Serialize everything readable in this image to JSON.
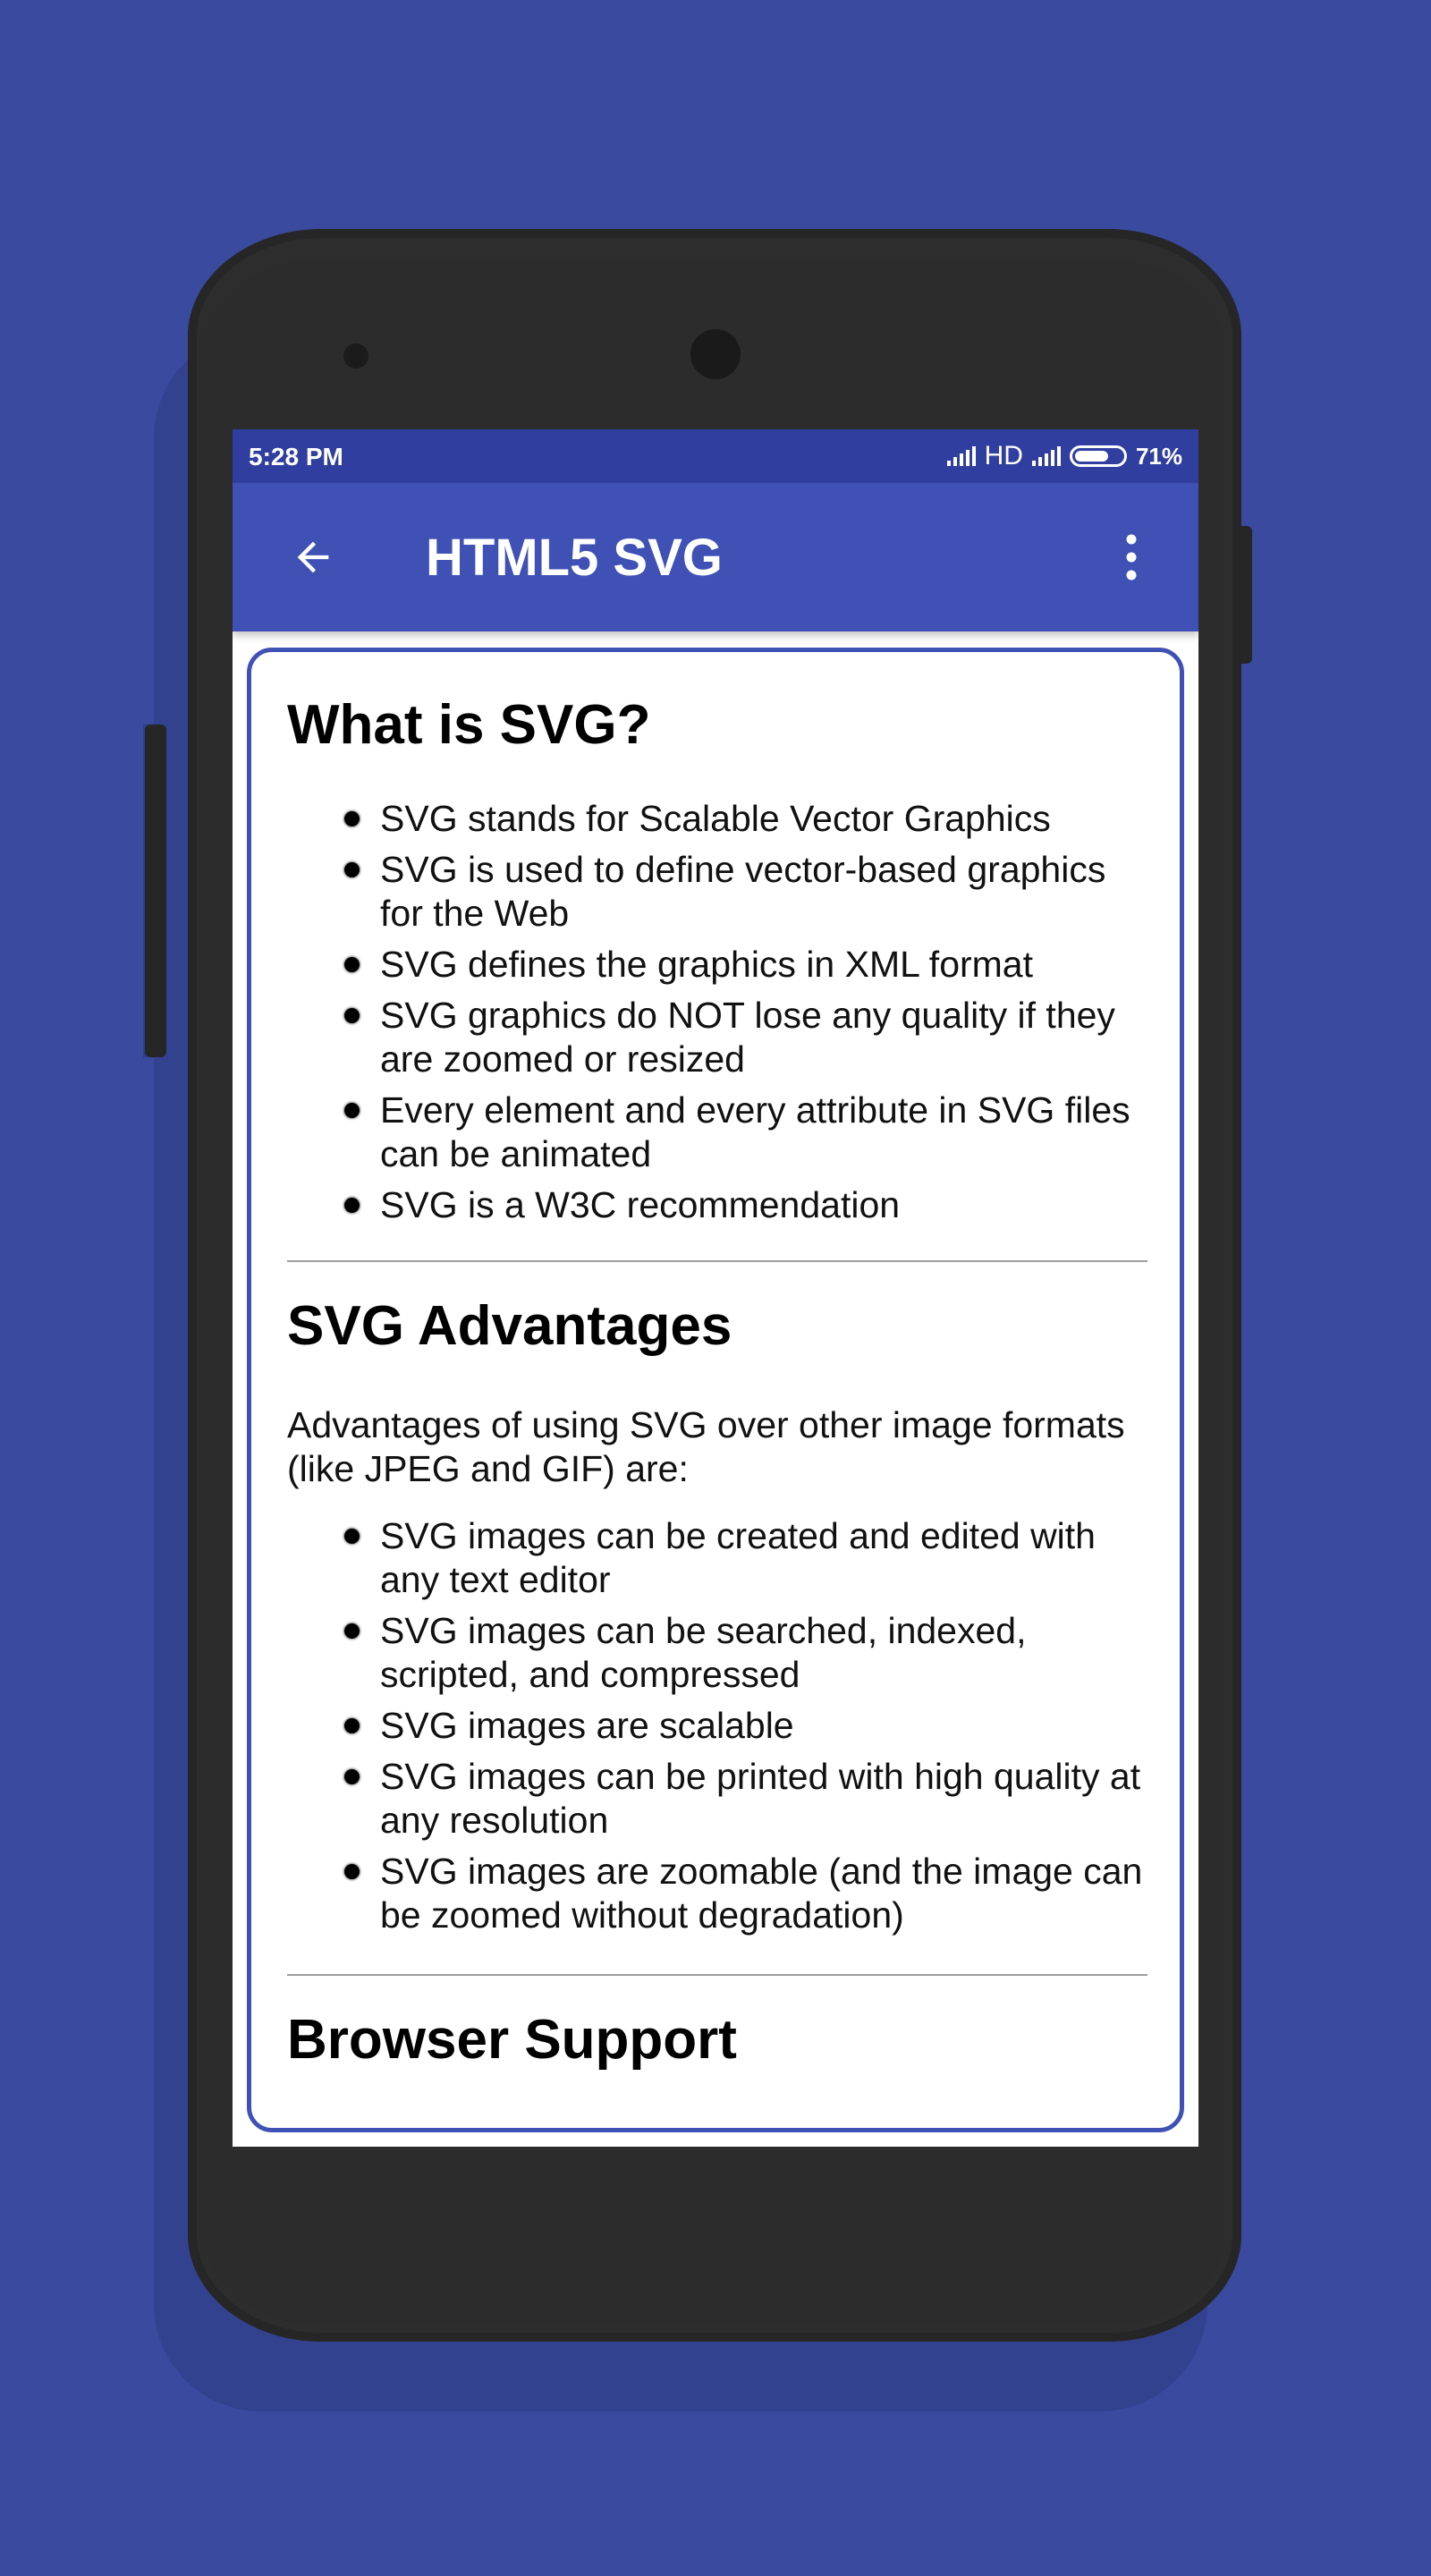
{
  "status_bar": {
    "time": "5:28 PM",
    "network": "HD",
    "battery": "71%",
    "battery_level": 0.71,
    "color": "#303f9f"
  },
  "toolbar": {
    "title": "HTML5 SVG",
    "back_icon": "arrow-left-icon",
    "menu_icon": "more-vert-icon",
    "color": "#3f51b5"
  },
  "content": {
    "section1": {
      "heading": "What is SVG?",
      "bullets": [
        "SVG stands for Scalable Vector Graphics",
        "SVG is used to define vector-based graphics for the Web",
        "SVG defines the graphics in XML format",
        "SVG graphics do NOT lose any quality if they are zoomed or resized",
        "Every element and every attribute in SVG files can be animated",
        "SVG is a W3C recommendation"
      ]
    },
    "section2": {
      "heading": "SVG Advantages",
      "intro": "Advantages of using SVG over other image formats (like JPEG and GIF) are:",
      "bullets": [
        "SVG images can be created and edited with any text editor",
        "SVG images can be searched, indexed, scripted, and compressed",
        "SVG images are scalable",
        "SVG images can be printed with high quality at any resolution",
        "SVG images are zoomable (and the image can be zoomed without degradation)"
      ]
    },
    "section3": {
      "heading": "Browser Support"
    }
  },
  "colors": {
    "background": "#394a9f",
    "accent": "#3f51b5",
    "phone_body": "#2d2d2d"
  }
}
